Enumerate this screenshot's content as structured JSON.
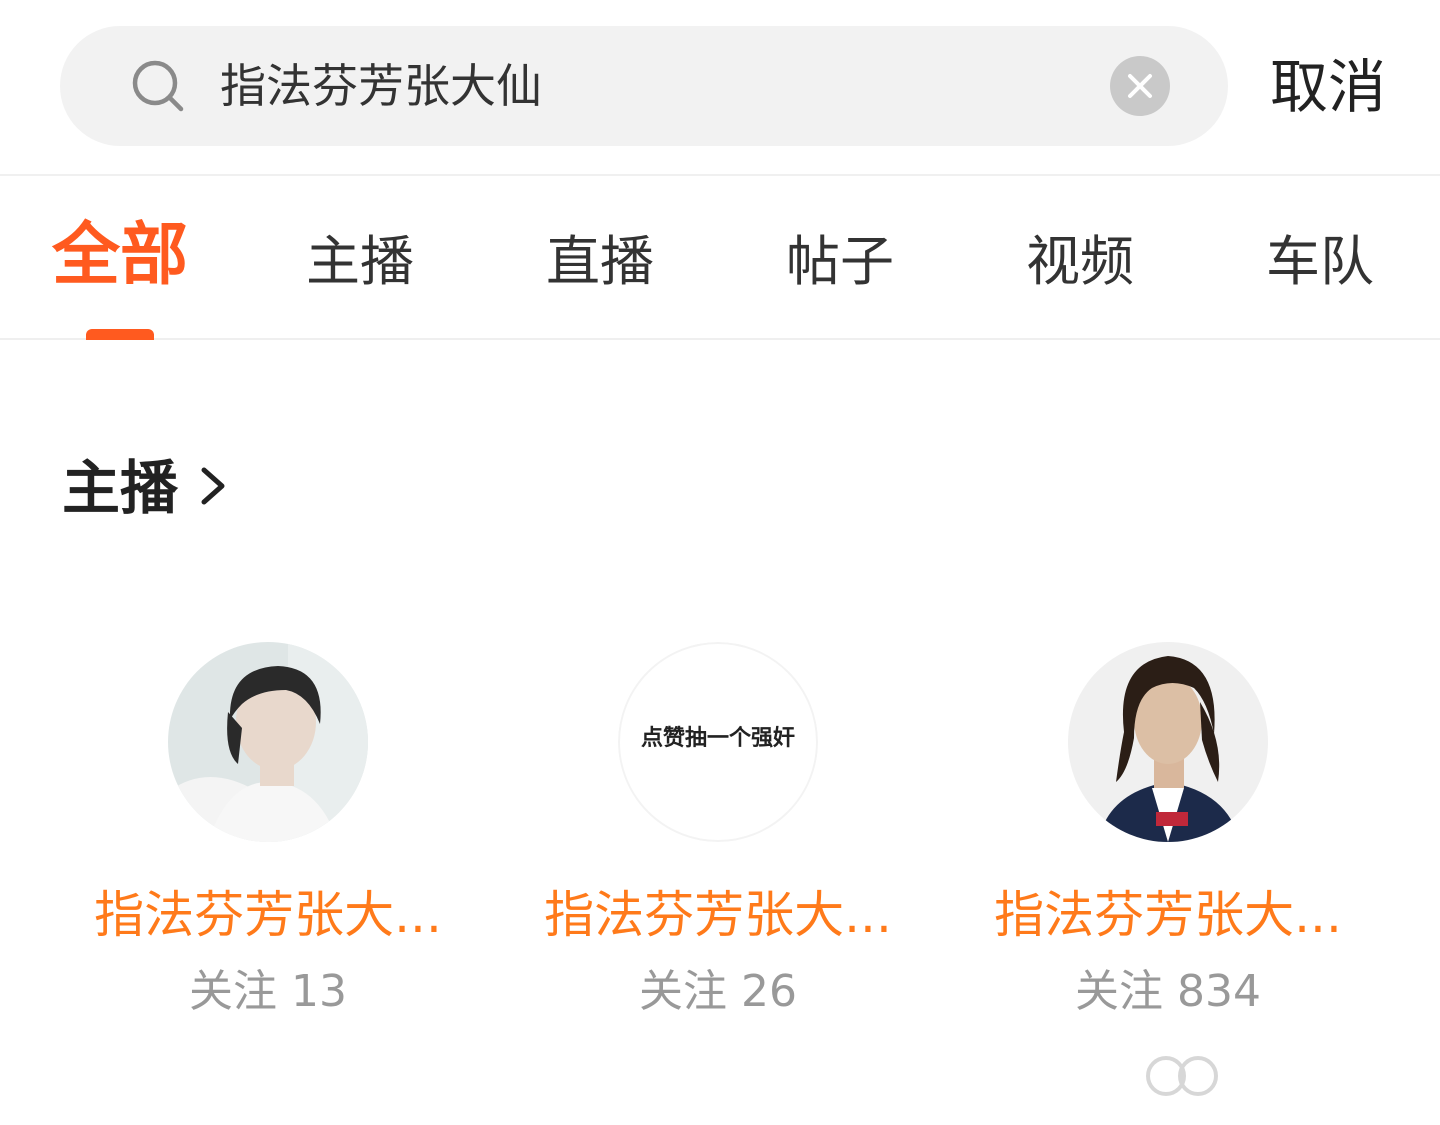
{
  "search": {
    "query": "指法芬芳张大仙",
    "cancel_label": "取消",
    "icon": "search-icon",
    "clear_icon": "clear-icon"
  },
  "tabs": [
    {
      "label": "全部",
      "active": true
    },
    {
      "label": "主播",
      "active": false
    },
    {
      "label": "直播",
      "active": false
    },
    {
      "label": "帖子",
      "active": false
    },
    {
      "label": "视频",
      "active": false
    },
    {
      "label": "车队",
      "active": false
    }
  ],
  "section": {
    "title": "主播",
    "chevron_icon": "chevron-right-icon"
  },
  "streamers": [
    {
      "name": "指法芬芳张大...",
      "followers": "关注 13"
    },
    {
      "name": "指法芬芳张大...",
      "followers": "关注 26",
      "avatar_text": "点赞抽一个强奸"
    },
    {
      "name": "指法芬芳张大...",
      "followers": "关注 834"
    }
  ],
  "colors": {
    "accent": "#ff5a1f",
    "name": "#ff7a1a",
    "muted": "#999999"
  }
}
